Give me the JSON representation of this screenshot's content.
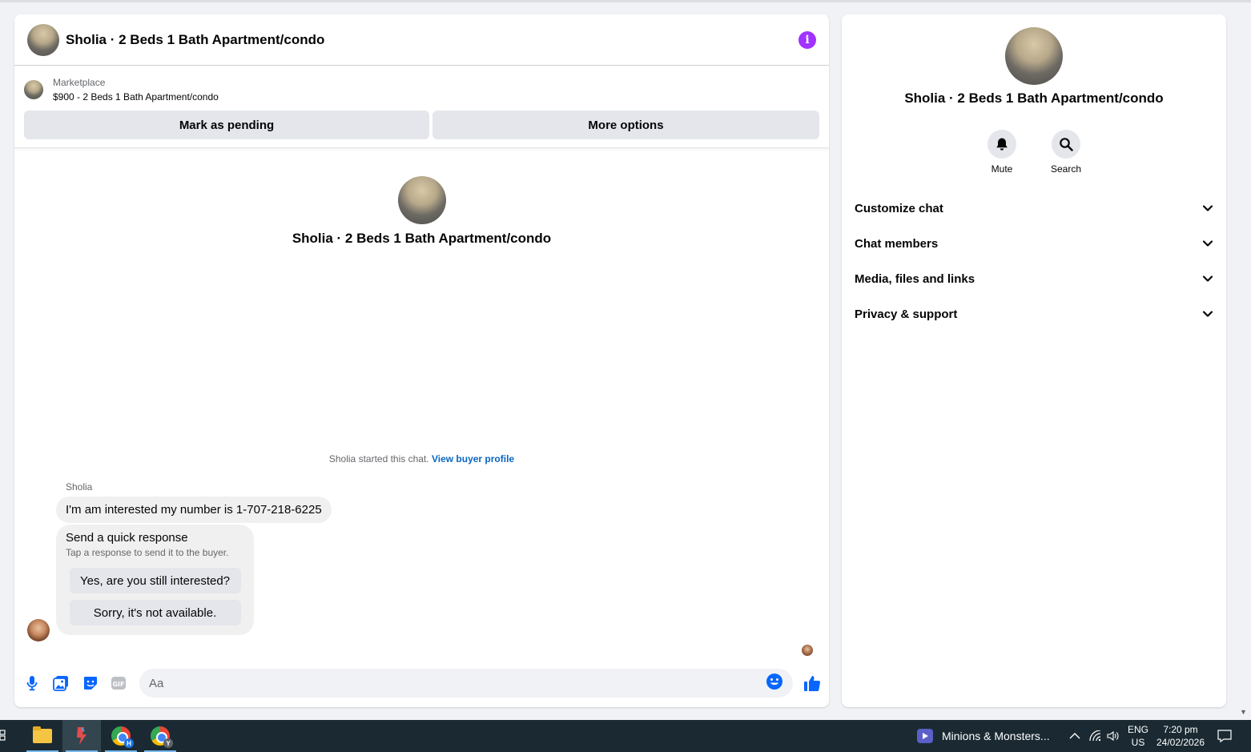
{
  "chat": {
    "title": "Sholia · 2 Beds 1 Bath Apartment/condo",
    "marketplace_label": "Marketplace",
    "listing": "$900 - 2 Beds 1 Bath Apartment/condo",
    "mark_pending_label": "Mark as pending",
    "more_options_label": "More options",
    "intro_title": "Sholia · 2 Beds 1 Bath Apartment/condo",
    "started_text": "Sholia started this chat.",
    "view_profile_label": "View buyer profile",
    "sender_name": "Sholia",
    "message": "I'm am interested my number is 1-707-218-6225",
    "quick_title": "Send a quick response",
    "quick_subtitle": "Tap a response to send it to the buyer.",
    "quick_replies": [
      "Yes, are you still interested?",
      "Sorry, it's not available."
    ],
    "composer_placeholder": "Aa"
  },
  "side": {
    "title": "Sholia · 2 Beds 1 Bath Apartment/condo",
    "actions": [
      {
        "label": "Mute",
        "icon": "bell-icon"
      },
      {
        "label": "Search",
        "icon": "search-icon"
      }
    ],
    "sections": [
      "Customize chat",
      "Chat members",
      "Media, files and links",
      "Privacy & support"
    ]
  },
  "taskbar": {
    "media_title": "Minions & Monsters...",
    "lang_line1": "ENG",
    "lang_line2": "US",
    "time": "7:20 pm",
    "date": "24/02/2026",
    "chrome_badges": [
      "H",
      "Y"
    ]
  },
  "colors": {
    "accent_blue": "#0a66c2",
    "messenger_blue": "#0866ff",
    "info_purple": "#a033ff",
    "taskbar_bg": "#1b2a32"
  }
}
